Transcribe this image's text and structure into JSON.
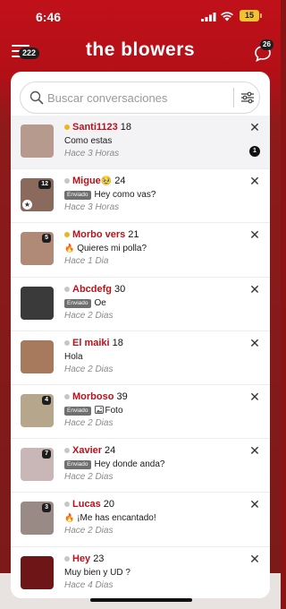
{
  "status_bar": {
    "time": "6:46",
    "battery": "15"
  },
  "header": {
    "title": "the blowers",
    "menu_badge": "222",
    "chat_badge": "26"
  },
  "search": {
    "placeholder": "Buscar conversaciones"
  },
  "conversations": [
    {
      "name": "Santi1123",
      "age": "18",
      "online": true,
      "sent": false,
      "prefix": "",
      "message": "Como estas",
      "time": "Hace 3 Horas",
      "pic_count": "",
      "unread": "1",
      "selected": true,
      "avatar_color": "#b79a8e"
    },
    {
      "name": "Migue",
      "age": "24",
      "online": false,
      "sent": true,
      "prefix": "",
      "message": "Hey como vas?",
      "time": "Hace 3 Horas",
      "pic_count": "12",
      "unread": "",
      "selected": false,
      "avatar_color": "#8a6a5c",
      "name_emoji": "🥹",
      "star": true
    },
    {
      "name": "Morbo vers",
      "age": "21",
      "online": true,
      "sent": false,
      "prefix": "fire",
      "message": "Quieres mi polla?",
      "time": "Hace 1 Dia",
      "pic_count": "5",
      "unread": "",
      "selected": false,
      "avatar_color": "#b08a76"
    },
    {
      "name": "Abcdefg",
      "age": "30",
      "online": false,
      "sent": true,
      "prefix": "",
      "message": "Oe",
      "time": "Hace 2 Dias",
      "pic_count": "",
      "unread": "",
      "selected": false,
      "avatar_color": "#3a3a3a"
    },
    {
      "name": "El maiki",
      "age": "18",
      "online": false,
      "sent": false,
      "prefix": "",
      "message": "Hola",
      "time": "Hace 2 Dias",
      "pic_count": "",
      "unread": "",
      "selected": false,
      "avatar_color": "#a77a5e"
    },
    {
      "name": "Morboso",
      "age": "39",
      "online": false,
      "sent": true,
      "prefix": "photo",
      "message": "Foto",
      "time": "Hace 2 Dias",
      "pic_count": "4",
      "unread": "",
      "selected": false,
      "avatar_color": "#b5a68c"
    },
    {
      "name": "Xavier",
      "age": "24",
      "online": false,
      "sent": true,
      "prefix": "",
      "message": "Hey donde anda?",
      "time": "Hace 2 Dias",
      "pic_count": "7",
      "unread": "",
      "selected": false,
      "avatar_color": "#c9b6b6"
    },
    {
      "name": "Lucas",
      "age": "20",
      "online": false,
      "sent": false,
      "prefix": "fire",
      "message": "¡Me has encantado!",
      "time": "Hace 2 Dias",
      "pic_count": "3",
      "unread": "",
      "selected": false,
      "avatar_color": "#9a8a86"
    },
    {
      "name": "Hey",
      "age": "23",
      "online": false,
      "sent": false,
      "prefix": "",
      "message": "Muy bien y UD ?",
      "time": "Hace 4 Dias",
      "pic_count": "",
      "unread": "",
      "selected": false,
      "avatar_color": "#6e1518"
    }
  ],
  "labels": {
    "sent_tag": "Enviado",
    "close": "✕"
  },
  "colors": {
    "brand_red": "#b9121b",
    "online": "#f0b323",
    "offline": "#c7c7c7"
  }
}
